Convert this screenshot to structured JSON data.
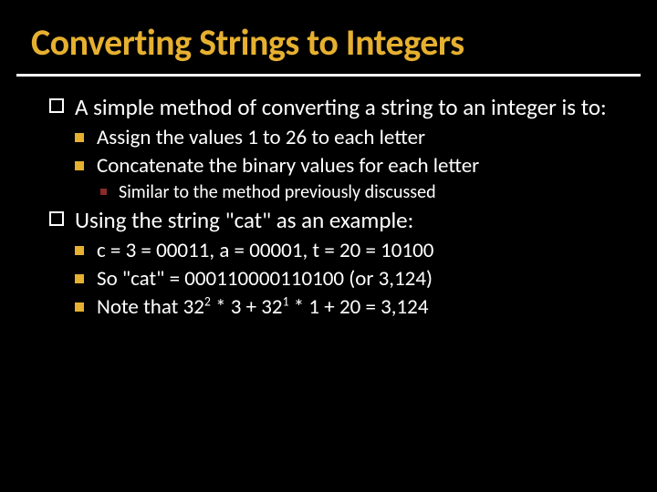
{
  "title": "Converting Strings to Integers",
  "b1": {
    "text": "A simple method of converting a string to an integer is to:"
  },
  "b1s": {
    "a": "Assign the values 1 to 26 to each letter",
    "b": "Concatenate the binary values for each letter"
  },
  "b1ss": {
    "a": "Similar to the method previously discussed"
  },
  "b2": {
    "text": "Using the string \"cat\" as an example:"
  },
  "b2s": {
    "a": "c = 3 = 00011, a = 00001, t = 20 = 10100",
    "b": "So \"cat\" = 000110000110100 (or 3,124)",
    "c_pre": "Note that 32",
    "c_sup1": "2",
    "c_mid1": " * 3 + 32",
    "c_sup2": "1",
    "c_mid2": " * 1 + 20 = 3,124"
  }
}
